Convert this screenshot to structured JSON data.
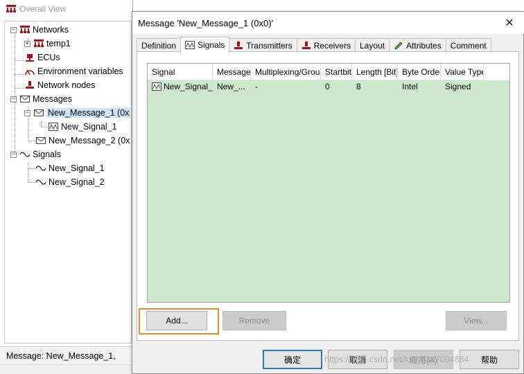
{
  "tree": {
    "title": "Overall View",
    "nodes": {
      "networks": "Networks",
      "temp1": "temp1",
      "ecus": "ECUs",
      "env_vars": "Environment variables",
      "network_nodes": "Network nodes",
      "messages": "Messages",
      "msg1": "New_Message_1 (0x",
      "msg1_signal": "New_Signal_1",
      "msg2": "New_Message_2 (0x",
      "signals": "Signals",
      "signal1": "New_Signal_1",
      "signal2": "New_Signal_2"
    },
    "status": "Message: New_Message_1,"
  },
  "dialog": {
    "title": "Message 'New_Message_1 (0x0)'",
    "close_glyph": "✕",
    "tabs": [
      "Definition",
      "Signals",
      "Transmitters",
      "Receivers",
      "Layout",
      "Attributes",
      "Comment"
    ],
    "table": {
      "headers": [
        "Signal",
        "Message",
        "Multiplexing/Group",
        "Startbit",
        "Length [Bit]",
        "Byte Order",
        "Value Type"
      ],
      "rows": [
        [
          "New_Signal_1",
          "New_...",
          "-",
          "0",
          "8",
          "Intel",
          "Signed"
        ]
      ]
    },
    "buttons": {
      "add": "Add...",
      "remove": "Remove",
      "view": "View...",
      "ok": "确定",
      "cancel": "取消",
      "apply": "应用(A)",
      "help": "帮助"
    },
    "watermark": "https://blog.csdn.net/luohd307004884"
  },
  "colors": {
    "list_background": "#cde8cc",
    "highlight_box": "#f08a24",
    "default_button_border": "#2b78d0"
  }
}
